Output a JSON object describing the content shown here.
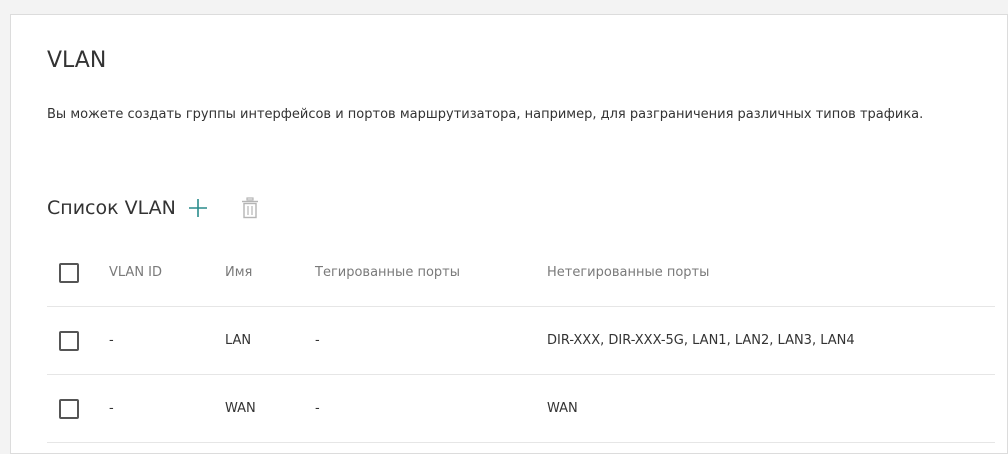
{
  "page": {
    "title": "VLAN",
    "description": "Вы можете создать группы интерфейсов и портов маршрутизатора, например, для разграничения различных типов трафика."
  },
  "vlan_list": {
    "title": "Список VLAN",
    "add_icon": "plus-icon",
    "delete_icon": "trash-icon",
    "columns": {
      "vlan_id": "VLAN ID",
      "name": "Имя",
      "tagged": "Тегированные порты",
      "untagged": "Нетегированные порты"
    },
    "rows": [
      {
        "vlan_id": "-",
        "name": "LAN",
        "tagged": "-",
        "untagged": "DIR-XXX, DIR-XXX-5G, LAN1, LAN2, LAN3, LAN4"
      },
      {
        "vlan_id": "-",
        "name": "WAN",
        "tagged": "-",
        "untagged": "WAN"
      }
    ]
  },
  "colors": {
    "accent": "#2a8c8c",
    "icon_disabled": "#b5b5b5"
  }
}
